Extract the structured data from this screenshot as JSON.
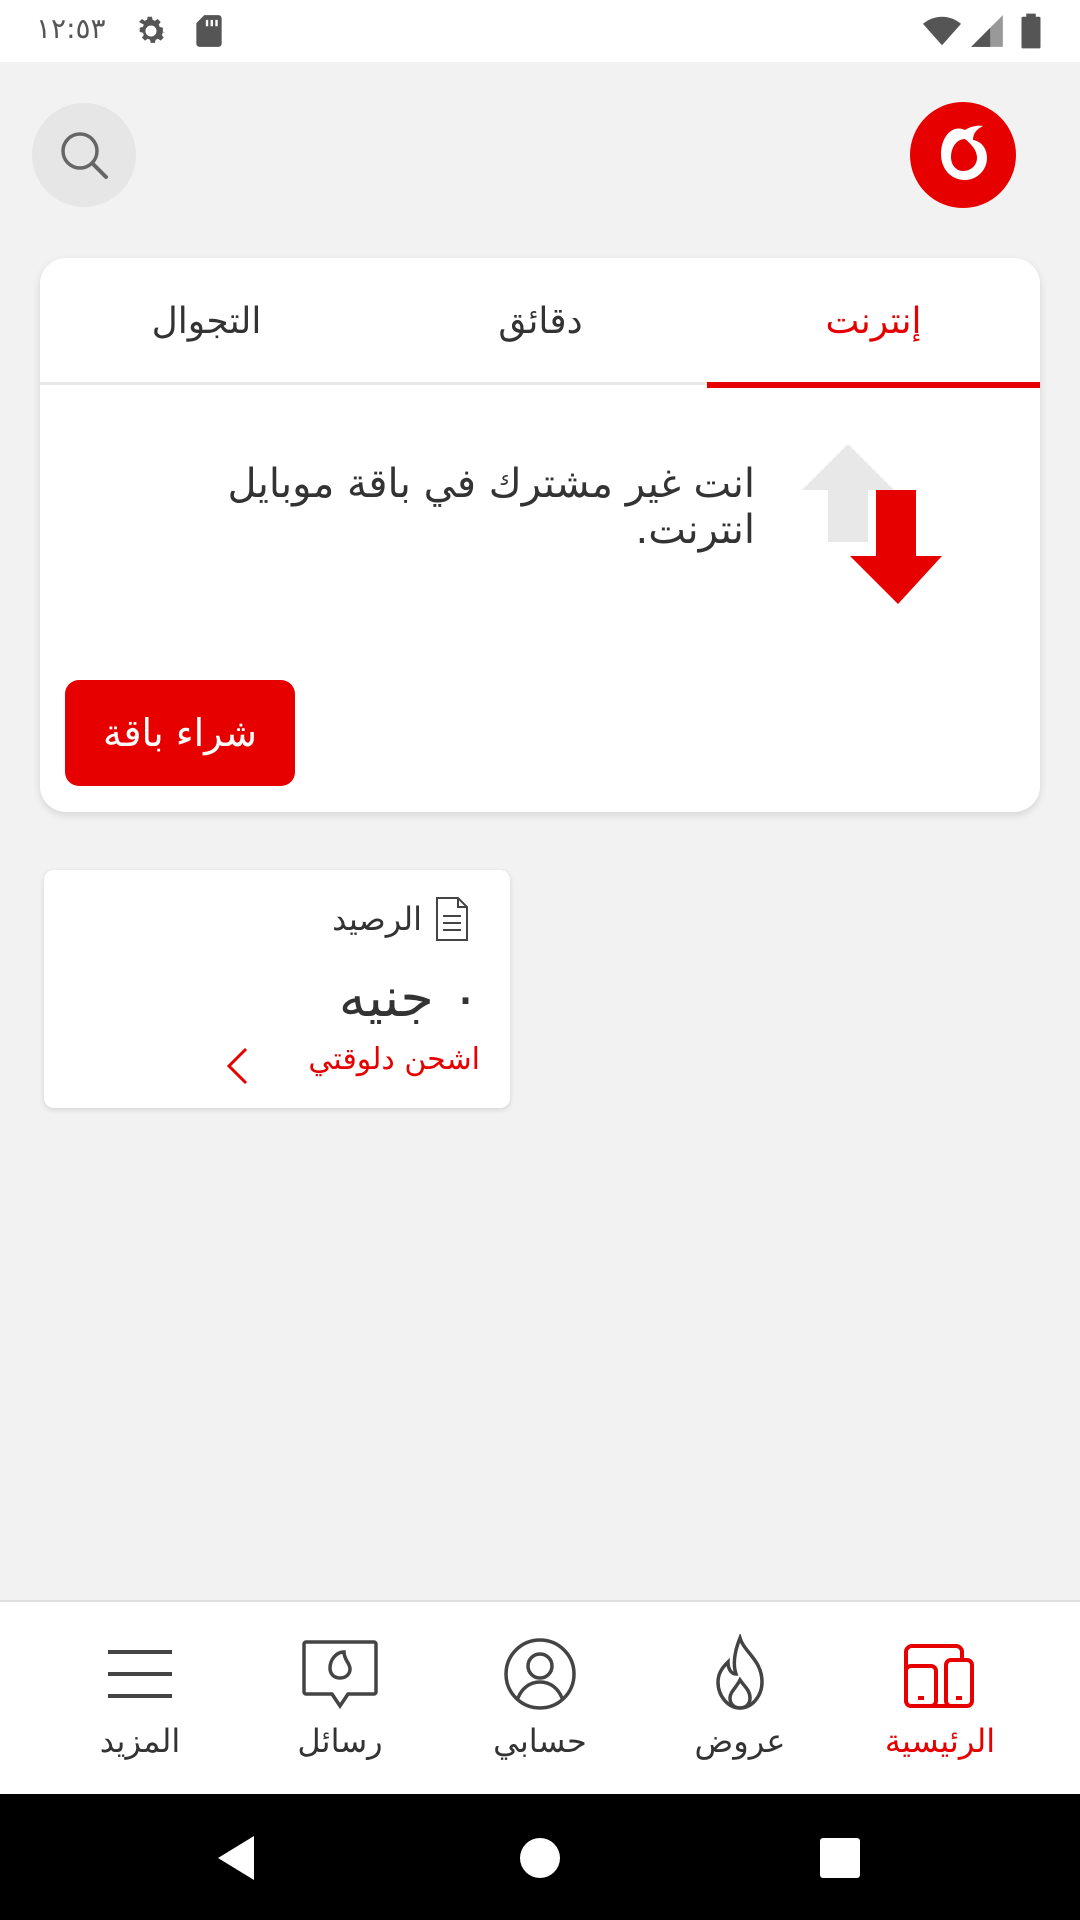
{
  "status_bar": {
    "time": "١٢:٥٣",
    "icons": [
      "settings-icon",
      "sd-card-icon",
      "wifi-icon",
      "signal-icon",
      "battery-icon"
    ]
  },
  "header": {
    "logo": "vodafone-logo",
    "search_icon": "search-icon"
  },
  "usage_card": {
    "tabs": [
      {
        "label": "إنترنت",
        "active": true
      },
      {
        "label": "دقائق",
        "active": false
      },
      {
        "label": "التجوال",
        "active": false
      }
    ],
    "message": "انت غير مشترك في باقة موبايل انترنت.",
    "buy_button": "شراء باقة"
  },
  "balance_card": {
    "title": "الرصيد",
    "amount": "٠ جنيه",
    "recharge_link": "اشحن دلوقتي"
  },
  "bottom_nav": {
    "items": [
      {
        "label": "الرئيسية",
        "icon": "home-devices-icon",
        "active": true
      },
      {
        "label": "عروض",
        "icon": "flame-icon",
        "active": false
      },
      {
        "label": "حسابي",
        "icon": "account-icon",
        "active": false
      },
      {
        "label": "رسائل",
        "icon": "messages-icon",
        "active": false
      },
      {
        "label": "المزيد",
        "icon": "menu-icon",
        "active": false
      }
    ]
  },
  "colors": {
    "brand_red": "#e60000",
    "background": "#f2f2f2",
    "text": "#333333"
  }
}
